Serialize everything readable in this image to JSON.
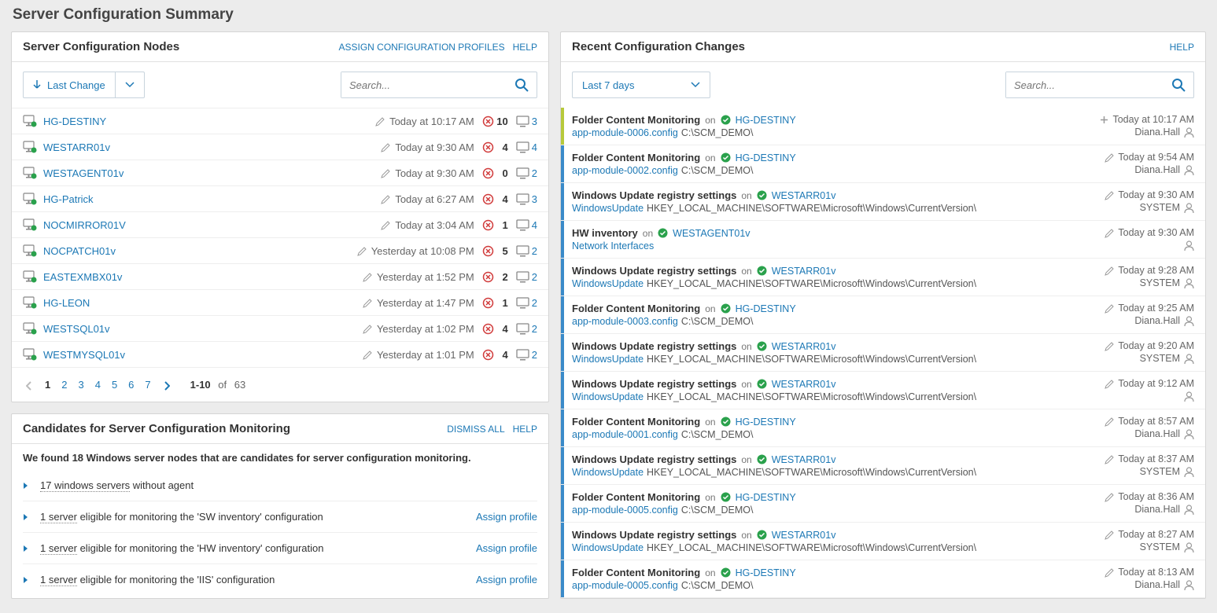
{
  "pageTitle": "Server Configuration Summary",
  "nodesPanel": {
    "title": "Server Configuration Nodes",
    "links": {
      "assign": "ASSIGN CONFIGURATION PROFILES",
      "help": "HELP"
    },
    "sortLabel": "Last Change",
    "searchPlaceholder": "Search...",
    "rows": [
      {
        "name": "HG-DESTINY",
        "time": "Today at 10:17 AM",
        "a": "10",
        "b": "3"
      },
      {
        "name": "WESTARR01v",
        "time": "Today at 9:30 AM",
        "a": "4",
        "b": "4"
      },
      {
        "name": "WESTAGENT01v",
        "time": "Today at 9:30 AM",
        "a": "0",
        "b": "2"
      },
      {
        "name": "HG-Patrick",
        "time": "Today at 6:27 AM",
        "a": "4",
        "b": "3"
      },
      {
        "name": "NOCMIRROR01V",
        "time": "Today at 3:04 AM",
        "a": "1",
        "b": "4"
      },
      {
        "name": "NOCPATCH01v",
        "time": "Yesterday at 10:08 PM",
        "a": "5",
        "b": "2"
      },
      {
        "name": "EASTEXMBX01v",
        "time": "Yesterday at 1:52 PM",
        "a": "2",
        "b": "2"
      },
      {
        "name": "HG-LEON",
        "time": "Yesterday at 1:47 PM",
        "a": "1",
        "b": "2"
      },
      {
        "name": "WESTSQL01v",
        "time": "Yesterday at 1:02 PM",
        "a": "4",
        "b": "2"
      },
      {
        "name": "WESTMYSQL01v",
        "time": "Yesterday at 1:01 PM",
        "a": "4",
        "b": "2"
      }
    ],
    "pagination": {
      "pages": [
        "1",
        "2",
        "3",
        "4",
        "5",
        "6",
        "7"
      ],
      "current": 1,
      "range": "1-10",
      "of": "of",
      "total": "63"
    }
  },
  "candidatesPanel": {
    "title": "Candidates for Server Configuration Monitoring",
    "links": {
      "dismiss": "DISMISS ALL",
      "help": "HELP"
    },
    "intro": "We found 18 Windows server nodes that are candidates for server configuration monitoring.",
    "rows": [
      {
        "dotted": "17 windows servers",
        "rest": " without agent",
        "action": ""
      },
      {
        "dotted": "1 server",
        "rest": " eligible for monitoring the 'SW inventory' configuration",
        "action": "Assign profile"
      },
      {
        "dotted": "1 server",
        "rest": " eligible for monitoring the 'HW inventory' configuration",
        "action": "Assign profile"
      },
      {
        "dotted": "1 server",
        "rest": " eligible for monitoring the 'IIS' configuration",
        "action": "Assign profile"
      }
    ]
  },
  "changesPanel": {
    "title": "Recent Configuration Changes",
    "links": {
      "help": "HELP"
    },
    "rangeLabel": "Last 7 days",
    "searchPlaceholder": "Search...",
    "onLabel": "on",
    "rows": [
      {
        "new": true,
        "title": "Folder Content Monitoring",
        "server": "HG-DESTINY",
        "item": "app-module-0006.config",
        "path": "C:\\SCM_DEMO\\",
        "icon": "plus",
        "time": "Today at 10:17 AM",
        "user": "Diana.Hall"
      },
      {
        "new": false,
        "title": "Folder Content Monitoring",
        "server": "HG-DESTINY",
        "item": "app-module-0002.config",
        "path": "C:\\SCM_DEMO\\",
        "icon": "pencil",
        "time": "Today at 9:54 AM",
        "user": "Diana.Hall"
      },
      {
        "new": false,
        "title": "Windows Update registry settings",
        "server": "WESTARR01v",
        "item": "WindowsUpdate",
        "path": "HKEY_LOCAL_MACHINE\\SOFTWARE\\Microsoft\\Windows\\CurrentVersion\\",
        "icon": "pencil",
        "time": "Today at 9:30 AM",
        "user": "SYSTEM"
      },
      {
        "new": false,
        "title": "HW inventory",
        "server": "WESTAGENT01v",
        "item": "Network Interfaces",
        "path": "",
        "icon": "pencil",
        "time": "Today at 9:30 AM",
        "user": ""
      },
      {
        "new": false,
        "title": "Windows Update registry settings",
        "server": "WESTARR01v",
        "item": "WindowsUpdate",
        "path": "HKEY_LOCAL_MACHINE\\SOFTWARE\\Microsoft\\Windows\\CurrentVersion\\",
        "icon": "pencil",
        "time": "Today at 9:28 AM",
        "user": "SYSTEM"
      },
      {
        "new": false,
        "title": "Folder Content Monitoring",
        "server": "HG-DESTINY",
        "item": "app-module-0003.config",
        "path": "C:\\SCM_DEMO\\",
        "icon": "pencil",
        "time": "Today at 9:25 AM",
        "user": "Diana.Hall"
      },
      {
        "new": false,
        "title": "Windows Update registry settings",
        "server": "WESTARR01v",
        "item": "WindowsUpdate",
        "path": "HKEY_LOCAL_MACHINE\\SOFTWARE\\Microsoft\\Windows\\CurrentVersion\\",
        "icon": "pencil",
        "time": "Today at 9:20 AM",
        "user": "SYSTEM"
      },
      {
        "new": false,
        "title": "Windows Update registry settings",
        "server": "WESTARR01v",
        "item": "WindowsUpdate",
        "path": "HKEY_LOCAL_MACHINE\\SOFTWARE\\Microsoft\\Windows\\CurrentVersion\\",
        "icon": "pencil",
        "time": "Today at 9:12 AM",
        "user": ""
      },
      {
        "new": false,
        "title": "Folder Content Monitoring",
        "server": "HG-DESTINY",
        "item": "app-module-0001.config",
        "path": "C:\\SCM_DEMO\\",
        "icon": "pencil",
        "time": "Today at 8:57 AM",
        "user": "Diana.Hall"
      },
      {
        "new": false,
        "title": "Windows Update registry settings",
        "server": "WESTARR01v",
        "item": "WindowsUpdate",
        "path": "HKEY_LOCAL_MACHINE\\SOFTWARE\\Microsoft\\Windows\\CurrentVersion\\",
        "icon": "pencil",
        "time": "Today at 8:37 AM",
        "user": "SYSTEM"
      },
      {
        "new": false,
        "title": "Folder Content Monitoring",
        "server": "HG-DESTINY",
        "item": "app-module-0005.config",
        "path": "C:\\SCM_DEMO\\",
        "icon": "pencil",
        "time": "Today at 8:36 AM",
        "user": "Diana.Hall"
      },
      {
        "new": false,
        "title": "Windows Update registry settings",
        "server": "WESTARR01v",
        "item": "WindowsUpdate",
        "path": "HKEY_LOCAL_MACHINE\\SOFTWARE\\Microsoft\\Windows\\CurrentVersion\\",
        "icon": "pencil",
        "time": "Today at 8:27 AM",
        "user": "SYSTEM"
      },
      {
        "new": false,
        "title": "Folder Content Monitoring",
        "server": "HG-DESTINY",
        "item": "app-module-0005.config",
        "path": "C:\\SCM_DEMO\\",
        "icon": "pencil",
        "time": "Today at 8:13 AM",
        "user": "Diana.Hall"
      }
    ]
  }
}
